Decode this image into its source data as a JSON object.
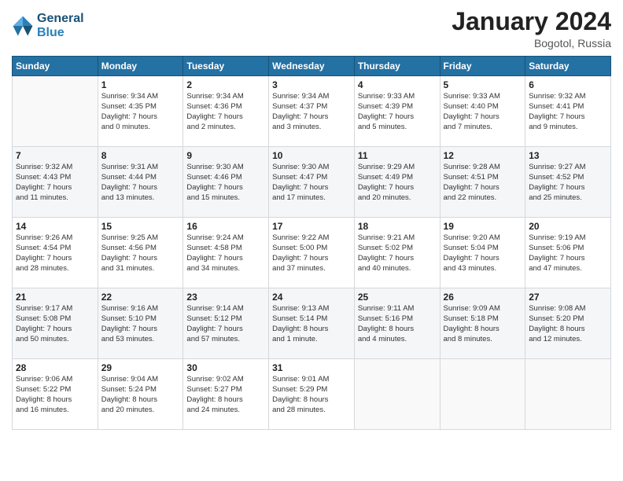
{
  "header": {
    "logo_line1": "General",
    "logo_line2": "Blue",
    "month_title": "January 2024",
    "location": "Bogotol, Russia"
  },
  "days_of_week": [
    "Sunday",
    "Monday",
    "Tuesday",
    "Wednesday",
    "Thursday",
    "Friday",
    "Saturday"
  ],
  "weeks": [
    [
      {
        "day": "",
        "info": ""
      },
      {
        "day": "1",
        "info": "Sunrise: 9:34 AM\nSunset: 4:35 PM\nDaylight: 7 hours\nand 0 minutes."
      },
      {
        "day": "2",
        "info": "Sunrise: 9:34 AM\nSunset: 4:36 PM\nDaylight: 7 hours\nand 2 minutes."
      },
      {
        "day": "3",
        "info": "Sunrise: 9:34 AM\nSunset: 4:37 PM\nDaylight: 7 hours\nand 3 minutes."
      },
      {
        "day": "4",
        "info": "Sunrise: 9:33 AM\nSunset: 4:39 PM\nDaylight: 7 hours\nand 5 minutes."
      },
      {
        "day": "5",
        "info": "Sunrise: 9:33 AM\nSunset: 4:40 PM\nDaylight: 7 hours\nand 7 minutes."
      },
      {
        "day": "6",
        "info": "Sunrise: 9:32 AM\nSunset: 4:41 PM\nDaylight: 7 hours\nand 9 minutes."
      }
    ],
    [
      {
        "day": "7",
        "info": "Sunrise: 9:32 AM\nSunset: 4:43 PM\nDaylight: 7 hours\nand 11 minutes."
      },
      {
        "day": "8",
        "info": "Sunrise: 9:31 AM\nSunset: 4:44 PM\nDaylight: 7 hours\nand 13 minutes."
      },
      {
        "day": "9",
        "info": "Sunrise: 9:30 AM\nSunset: 4:46 PM\nDaylight: 7 hours\nand 15 minutes."
      },
      {
        "day": "10",
        "info": "Sunrise: 9:30 AM\nSunset: 4:47 PM\nDaylight: 7 hours\nand 17 minutes."
      },
      {
        "day": "11",
        "info": "Sunrise: 9:29 AM\nSunset: 4:49 PM\nDaylight: 7 hours\nand 20 minutes."
      },
      {
        "day": "12",
        "info": "Sunrise: 9:28 AM\nSunset: 4:51 PM\nDaylight: 7 hours\nand 22 minutes."
      },
      {
        "day": "13",
        "info": "Sunrise: 9:27 AM\nSunset: 4:52 PM\nDaylight: 7 hours\nand 25 minutes."
      }
    ],
    [
      {
        "day": "14",
        "info": "Sunrise: 9:26 AM\nSunset: 4:54 PM\nDaylight: 7 hours\nand 28 minutes."
      },
      {
        "day": "15",
        "info": "Sunrise: 9:25 AM\nSunset: 4:56 PM\nDaylight: 7 hours\nand 31 minutes."
      },
      {
        "day": "16",
        "info": "Sunrise: 9:24 AM\nSunset: 4:58 PM\nDaylight: 7 hours\nand 34 minutes."
      },
      {
        "day": "17",
        "info": "Sunrise: 9:22 AM\nSunset: 5:00 PM\nDaylight: 7 hours\nand 37 minutes."
      },
      {
        "day": "18",
        "info": "Sunrise: 9:21 AM\nSunset: 5:02 PM\nDaylight: 7 hours\nand 40 minutes."
      },
      {
        "day": "19",
        "info": "Sunrise: 9:20 AM\nSunset: 5:04 PM\nDaylight: 7 hours\nand 43 minutes."
      },
      {
        "day": "20",
        "info": "Sunrise: 9:19 AM\nSunset: 5:06 PM\nDaylight: 7 hours\nand 47 minutes."
      }
    ],
    [
      {
        "day": "21",
        "info": "Sunrise: 9:17 AM\nSunset: 5:08 PM\nDaylight: 7 hours\nand 50 minutes."
      },
      {
        "day": "22",
        "info": "Sunrise: 9:16 AM\nSunset: 5:10 PM\nDaylight: 7 hours\nand 53 minutes."
      },
      {
        "day": "23",
        "info": "Sunrise: 9:14 AM\nSunset: 5:12 PM\nDaylight: 7 hours\nand 57 minutes."
      },
      {
        "day": "24",
        "info": "Sunrise: 9:13 AM\nSunset: 5:14 PM\nDaylight: 8 hours\nand 1 minute."
      },
      {
        "day": "25",
        "info": "Sunrise: 9:11 AM\nSunset: 5:16 PM\nDaylight: 8 hours\nand 4 minutes."
      },
      {
        "day": "26",
        "info": "Sunrise: 9:09 AM\nSunset: 5:18 PM\nDaylight: 8 hours\nand 8 minutes."
      },
      {
        "day": "27",
        "info": "Sunrise: 9:08 AM\nSunset: 5:20 PM\nDaylight: 8 hours\nand 12 minutes."
      }
    ],
    [
      {
        "day": "28",
        "info": "Sunrise: 9:06 AM\nSunset: 5:22 PM\nDaylight: 8 hours\nand 16 minutes."
      },
      {
        "day": "29",
        "info": "Sunrise: 9:04 AM\nSunset: 5:24 PM\nDaylight: 8 hours\nand 20 minutes."
      },
      {
        "day": "30",
        "info": "Sunrise: 9:02 AM\nSunset: 5:27 PM\nDaylight: 8 hours\nand 24 minutes."
      },
      {
        "day": "31",
        "info": "Sunrise: 9:01 AM\nSunset: 5:29 PM\nDaylight: 8 hours\nand 28 minutes."
      },
      {
        "day": "",
        "info": ""
      },
      {
        "day": "",
        "info": ""
      },
      {
        "day": "",
        "info": ""
      }
    ]
  ]
}
